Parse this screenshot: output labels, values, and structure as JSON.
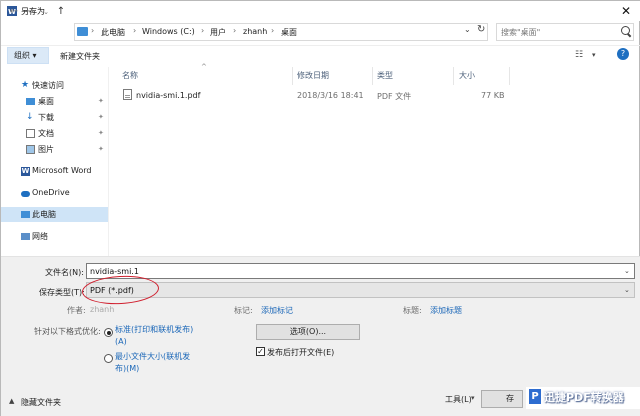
{
  "window": {
    "title": "另存为"
  },
  "nav": {
    "breadcrumbs": [
      "此电脑",
      "Windows (C:)",
      "用户",
      "zhanh",
      "桌面"
    ],
    "search_placeholder": "搜索\"桌面\""
  },
  "toolbar": {
    "organize": "组织 ▾",
    "new_folder": "新建文件夹"
  },
  "sidebar": {
    "items": [
      {
        "label": "快速访问",
        "icon": "star-icon",
        "pinned": false
      },
      {
        "label": "桌面",
        "icon": "desktop-icon",
        "pinned": true
      },
      {
        "label": "下载",
        "icon": "download-icon",
        "pinned": true
      },
      {
        "label": "文档",
        "icon": "document-icon",
        "pinned": true
      },
      {
        "label": "图片",
        "icon": "picture-icon",
        "pinned": true
      },
      {
        "label": "Microsoft Word",
        "icon": "word-icon",
        "pinned": false
      },
      {
        "label": "OneDrive",
        "icon": "cloud-icon",
        "pinned": false
      },
      {
        "label": "此电脑",
        "icon": "computer-icon",
        "pinned": false
      },
      {
        "label": "网络",
        "icon": "network-icon",
        "pinned": false
      }
    ],
    "selected": "此电脑"
  },
  "file_list": {
    "columns": [
      "名称",
      "修改日期",
      "类型",
      "大小"
    ],
    "rows": [
      {
        "name": "nvidia-smi.1.pdf",
        "modified": "2018/3/16 18:41",
        "type": "PDF 文件",
        "size": "77 KB"
      }
    ]
  },
  "form": {
    "filename_label": "文件名(N):",
    "filename_value": "nvidia-smi.1",
    "filetype_label": "保存类型(T):",
    "filetype_value": "PDF (*.pdf)",
    "author_label": "作者:",
    "author_value": "zhanh",
    "tags_label": "标记:",
    "tags_link": "添加标记",
    "title_label": "标题:",
    "title_link": "添加标题",
    "optimize_label": "针对以下格式优化:",
    "option_standard_line1": "标准(打印和联机发布)",
    "option_standard_line2": "(A)",
    "option_min_line1": "最小文件大小(联机发",
    "option_min_line2": "布)(M)",
    "options_button": "选项(O)...",
    "open_after_publish": "发布后打开文件(E)",
    "hide_folders": "隐藏文件夹",
    "tools": "工具(L)",
    "publish_partial": "存"
  },
  "watermark": {
    "text": "迅捷PDF转换器",
    "logo": "P"
  }
}
